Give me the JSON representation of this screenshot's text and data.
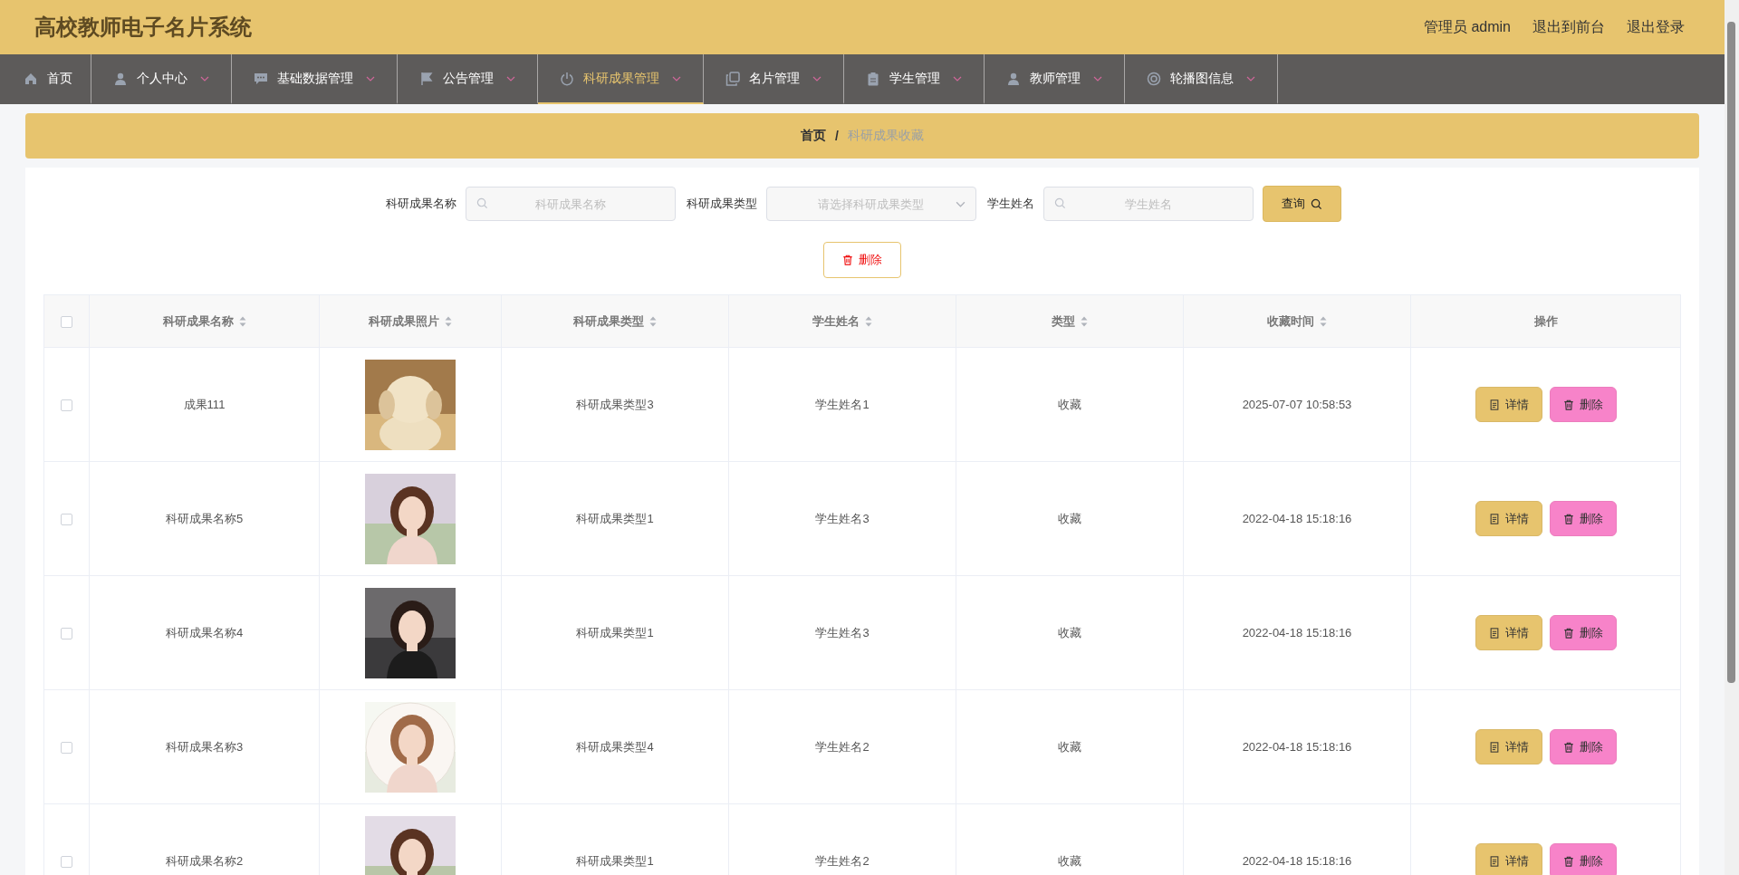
{
  "header": {
    "title": "高校教师电子名片系统",
    "links": [
      "管理员 admin",
      "退出到前台",
      "退出登录"
    ]
  },
  "nav": [
    {
      "label": "首页",
      "dropdown": false,
      "selected": false
    },
    {
      "label": "个人中心",
      "dropdown": true,
      "selected": false
    },
    {
      "label": "基础数据管理",
      "dropdown": true,
      "selected": false
    },
    {
      "label": "公告管理",
      "dropdown": true,
      "selected": false
    },
    {
      "label": "科研成果管理",
      "dropdown": true,
      "selected": true
    },
    {
      "label": "名片管理",
      "dropdown": true,
      "selected": false
    },
    {
      "label": "学生管理",
      "dropdown": true,
      "selected": false
    },
    {
      "label": "教师管理",
      "dropdown": true,
      "selected": false
    },
    {
      "label": "轮播图信息",
      "dropdown": true,
      "selected": false
    }
  ],
  "breadcrumb": {
    "items": [
      "首页",
      "科研成果收藏"
    ],
    "separator": "/"
  },
  "search": {
    "fields": [
      {
        "label": "科研成果名称",
        "kind": "text",
        "placeholder": "科研成果名称"
      },
      {
        "label": "科研成果类型",
        "kind": "select",
        "placeholder": "请选择科研成果类型"
      },
      {
        "label": "学生姓名",
        "kind": "text",
        "placeholder": "学生姓名"
      }
    ],
    "button": "查询"
  },
  "delete_button": "删除",
  "table": {
    "columns": [
      {
        "label": "科研成果名称",
        "sortable": true
      },
      {
        "label": "科研成果照片",
        "sortable": true
      },
      {
        "label": "科研成果类型",
        "sortable": true
      },
      {
        "label": "学生姓名",
        "sortable": true
      },
      {
        "label": "类型",
        "sortable": true
      },
      {
        "label": "收藏时间",
        "sortable": true
      },
      {
        "label": "操作",
        "sortable": false
      }
    ],
    "all_checked": false,
    "rows": [
      {
        "checked": false,
        "name": "成果111",
        "photo": {
          "kind": "picture"
        },
        "type": "科研成果类型3",
        "student": "学生姓名1",
        "category": "收藏",
        "time": "2025-07-07 10:58:53",
        "actions": [
          "详情",
          "删除"
        ]
      },
      {
        "checked": false,
        "name": "科研成果名称5",
        "photo": {
          "kind": "picture"
        },
        "type": "科研成果类型1",
        "student": "学生姓名3",
        "category": "收藏",
        "time": "2022-04-18 15:18:16",
        "actions": [
          "详情",
          "删除"
        ]
      },
      {
        "checked": false,
        "name": "科研成果名称4",
        "photo": {
          "kind": "picture"
        },
        "type": "科研成果类型1",
        "student": "学生姓名3",
        "category": "收藏",
        "time": "2022-04-18 15:18:16",
        "actions": [
          "详情",
          "删除"
        ]
      },
      {
        "checked": false,
        "name": "科研成果名称3",
        "photo": {
          "kind": "picture"
        },
        "type": "科研成果类型4",
        "student": "学生姓名2",
        "category": "收藏",
        "time": "2022-04-18 15:18:16",
        "actions": [
          "详情",
          "删除"
        ]
      },
      {
        "checked": false,
        "name": "科研成果名称2",
        "photo": {
          "kind": "picture"
        },
        "type": "科研成果类型1",
        "student": "学生姓名2",
        "category": "收藏",
        "time": "2022-04-18 15:18:16",
        "actions": [
          "详情",
          "删除"
        ]
      }
    ]
  }
}
